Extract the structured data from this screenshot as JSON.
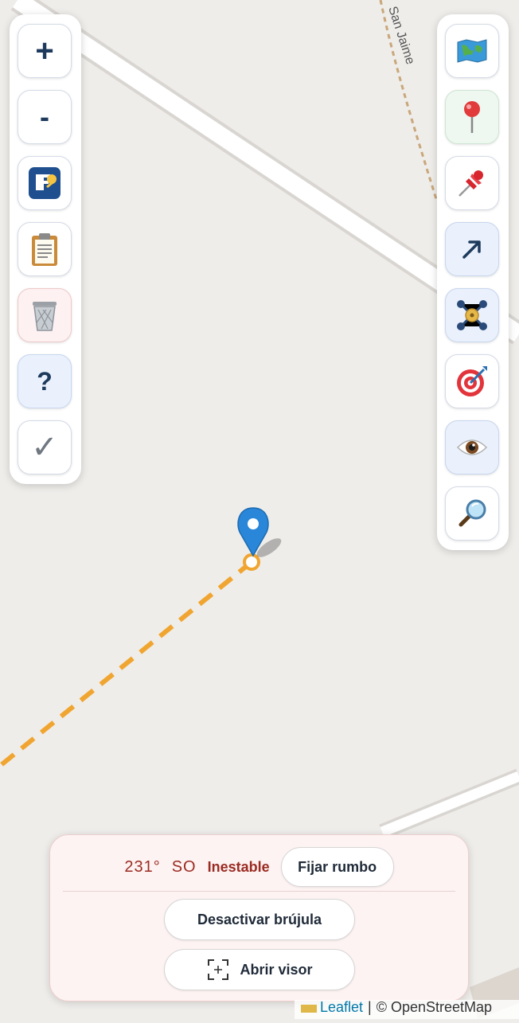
{
  "map": {
    "street_label": "San Jaime",
    "route_color": "#f0a531",
    "marker_color": "#2a86d8"
  },
  "left_toolbar": {
    "items": [
      {
        "name": "zoom-in",
        "glyph": "+",
        "icon": "plus-icon"
      },
      {
        "name": "zoom-out",
        "glyph": "-",
        "icon": "minus-icon"
      },
      {
        "name": "edit-track",
        "icon": "edit-icon"
      },
      {
        "name": "clipboard",
        "icon": "clipboard-icon"
      },
      {
        "name": "delete",
        "icon": "trash-icon"
      },
      {
        "name": "help",
        "glyph": "?",
        "icon": "question-icon"
      },
      {
        "name": "confirm",
        "glyph": "✓",
        "icon": "checkmark-icon"
      }
    ]
  },
  "right_toolbar": {
    "items": [
      {
        "name": "map-layers",
        "icon": "map-icon"
      },
      {
        "name": "place-marker",
        "icon": "round-pin-icon"
      },
      {
        "name": "pin-point",
        "icon": "pushpin-icon"
      },
      {
        "name": "direction",
        "icon": "arrow-icon"
      },
      {
        "name": "network",
        "icon": "nodes-icon"
      },
      {
        "name": "target",
        "icon": "target-icon"
      },
      {
        "name": "visibility",
        "icon": "eye-icon"
      },
      {
        "name": "search",
        "icon": "magnifier-icon"
      }
    ]
  },
  "compass": {
    "degrees": "231°",
    "direction": "SO",
    "status": "Inestable",
    "fix_heading_label": "Fijar rumbo",
    "disable_label": "Desactivar brújula",
    "open_viewer_label": "Abrir visor"
  },
  "attribution": {
    "leaflet": "Leaflet",
    "separator": "|",
    "osm": "© OpenStreetMap"
  }
}
